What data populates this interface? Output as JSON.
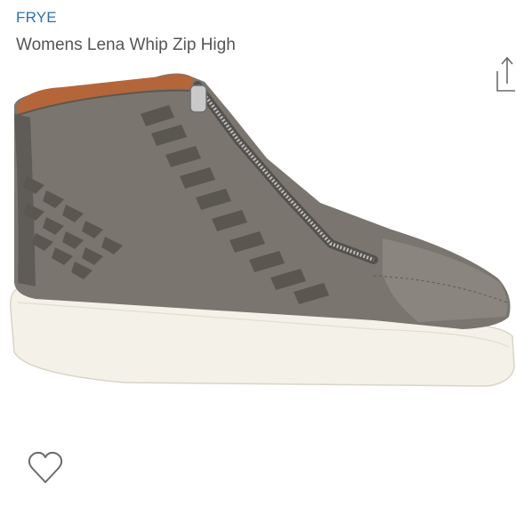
{
  "listing": {
    "brand": "FRYE",
    "title": "Womens Lena Whip Zip High"
  },
  "icons": {
    "share": "share-icon",
    "like": "heart-outline-icon"
  },
  "colors": {
    "brand_link": "#2f6fb3",
    "title_text": "#555555",
    "icon_stroke": "#6b6b6b",
    "shoe_leather": "#7a766f",
    "sole": "#f4f1e8"
  }
}
